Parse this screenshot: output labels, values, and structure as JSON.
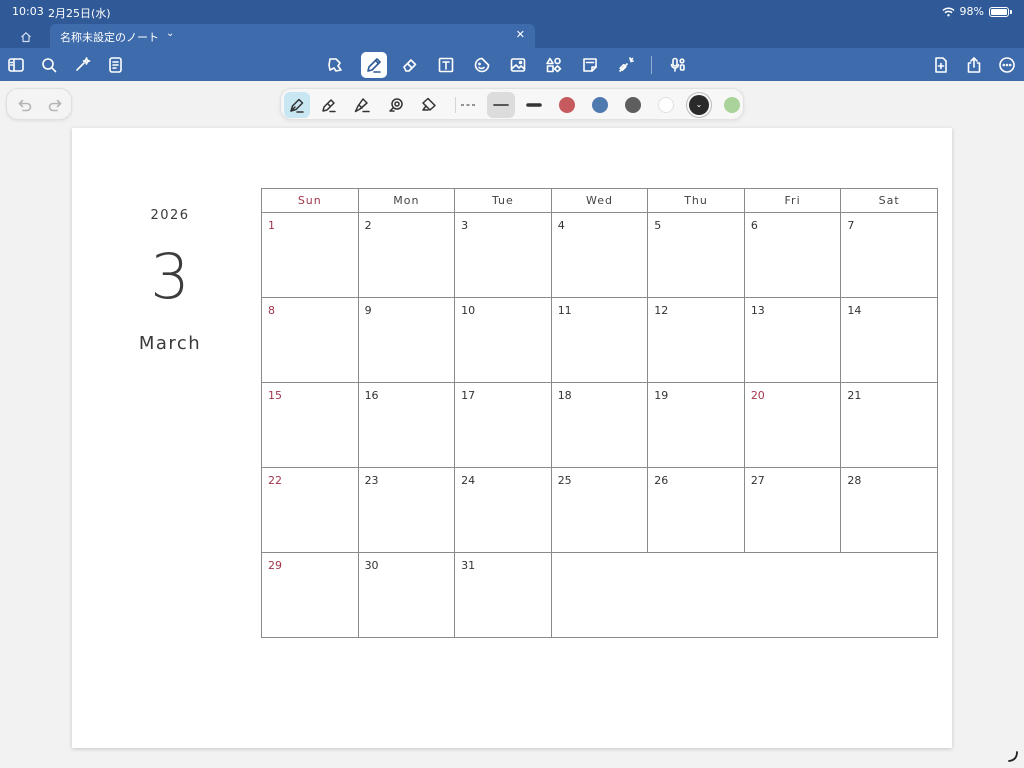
{
  "status": {
    "time": "10:03",
    "date": "2月25日(水)",
    "battery": "98%"
  },
  "tabs": {
    "doc_title": "名称未設定のノート",
    "chevron": "⌄",
    "close": "✕"
  },
  "toolbar_icons": [
    "sidebar-icon",
    "search-icon",
    "ai-sparkle-icon",
    "doc-list-icon",
    "lasso-icon",
    "pen-icon",
    "eraser-icon",
    "textbox-icon",
    "sticker-icon",
    "image-icon",
    "shapes-icon",
    "sticky-note-icon",
    "laser-pointer-icon",
    "mic-icon",
    "add-page-icon",
    "share-icon",
    "more-icon"
  ],
  "pen_tools": [
    "fountain-pen",
    "ballpoint-pen",
    "brush-pen",
    "lasso",
    "tape"
  ],
  "colors": {
    "topbar": "#2f5a97",
    "red": "#c65a5e",
    "blue": "#4f7aaf",
    "gray": "#5e5e5e",
    "white": "#ffffff",
    "black": "#2a2a2a",
    "green": "#a9d39a",
    "holiday": "#a3364d"
  },
  "calendar": {
    "year": "2026",
    "month_num": "3",
    "month_name": "March",
    "weekdays": [
      "Sun",
      "Mon",
      "Tue",
      "Wed",
      "Thu",
      "Fri",
      "Sat"
    ],
    "weeks": [
      [
        "1",
        "2",
        "3",
        "4",
        "5",
        "6",
        "7"
      ],
      [
        "8",
        "9",
        "10",
        "11",
        "12",
        "13",
        "14"
      ],
      [
        "15",
        "16",
        "17",
        "18",
        "19",
        "20",
        "21"
      ],
      [
        "22",
        "23",
        "24",
        "25",
        "26",
        "27",
        "28"
      ],
      [
        "29",
        "30",
        "31"
      ]
    ]
  }
}
